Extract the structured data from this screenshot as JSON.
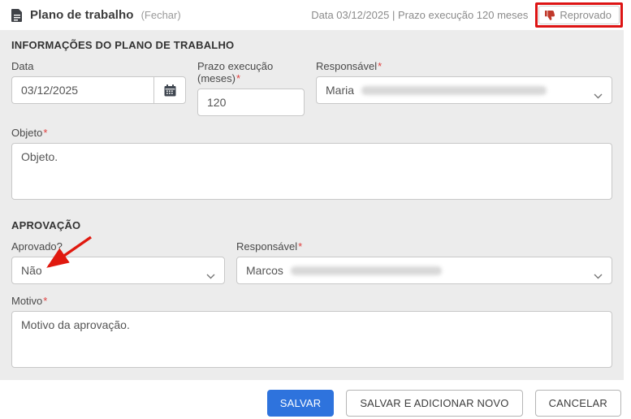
{
  "header": {
    "title": "Plano de trabalho",
    "close_label": "(Fechar)",
    "meta": "Data 03/12/2025 | Prazo execução 120 meses",
    "status_badge": "Reprovado"
  },
  "ui": {
    "required_mark": "*"
  },
  "section_info": {
    "title": "INFORMAÇÕES DO PLANO DE TRABALHO",
    "data_label": "Data",
    "data_value": "03/12/2025",
    "prazo_label": "Prazo execução (meses)",
    "prazo_value": "120",
    "responsavel_label": "Responsável",
    "responsavel_value": "Maria",
    "objeto_label": "Objeto",
    "objeto_value": "Objeto."
  },
  "section_aprovacao": {
    "title": "APROVAÇÃO",
    "aprovado_label": "Aprovado?",
    "aprovado_value": "Não",
    "responsavel_label": "Responsável",
    "responsavel_value": "Marcos",
    "motivo_label": "Motivo",
    "motivo_value": "Motivo da aprovação."
  },
  "footer": {
    "save_label": "SALVAR",
    "save_add_label": "SALVAR E ADICIONAR NOVO",
    "cancel_label": "CANCELAR"
  },
  "icons": {
    "document": "document-icon",
    "calendar": "calendar-icon",
    "chevron": "chevron-down-icon",
    "thumbs_down": "thumbs-down-icon",
    "annotation_arrow": "red-arrow-annotation"
  },
  "colors": {
    "primary_blue": "#2e73dd",
    "annotation_red": "#dd1414",
    "required_red": "#e0403f",
    "thumbs_red": "#c0392b",
    "panel_gray": "#ececec"
  }
}
